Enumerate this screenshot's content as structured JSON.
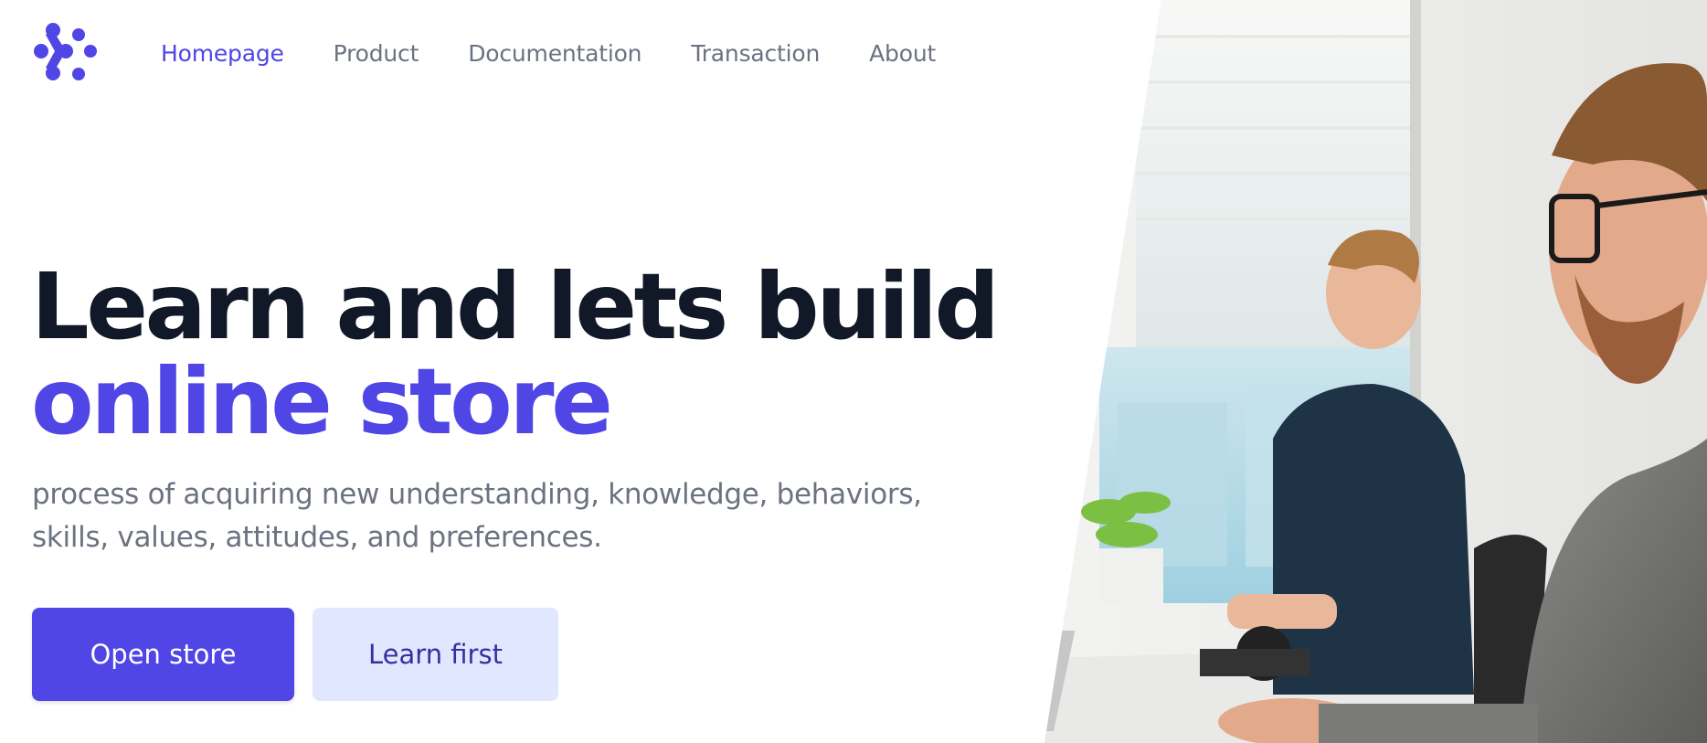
{
  "brand": {
    "logo_icon": "dots-logo-icon",
    "accent": "#4f46e5"
  },
  "nav": {
    "items": [
      {
        "label": "Homepage",
        "active": true
      },
      {
        "label": "Product",
        "active": false
      },
      {
        "label": "Documentation",
        "active": false
      },
      {
        "label": "Transaction",
        "active": false
      },
      {
        "label": "About",
        "active": false
      }
    ]
  },
  "hero": {
    "title_line1": "Learn and lets build",
    "title_line2": "online store",
    "description_line1": "process of acquiring new understanding, knowledge, behaviors,",
    "description_line2": "skills, values, attitudes, and preferences.",
    "primary_button": "Open store",
    "secondary_button": "Learn first"
  },
  "colors": {
    "title": "#111827",
    "muted": "#6b7280",
    "secondary_bg": "#e0e7ff",
    "secondary_text": "#3730a3"
  }
}
